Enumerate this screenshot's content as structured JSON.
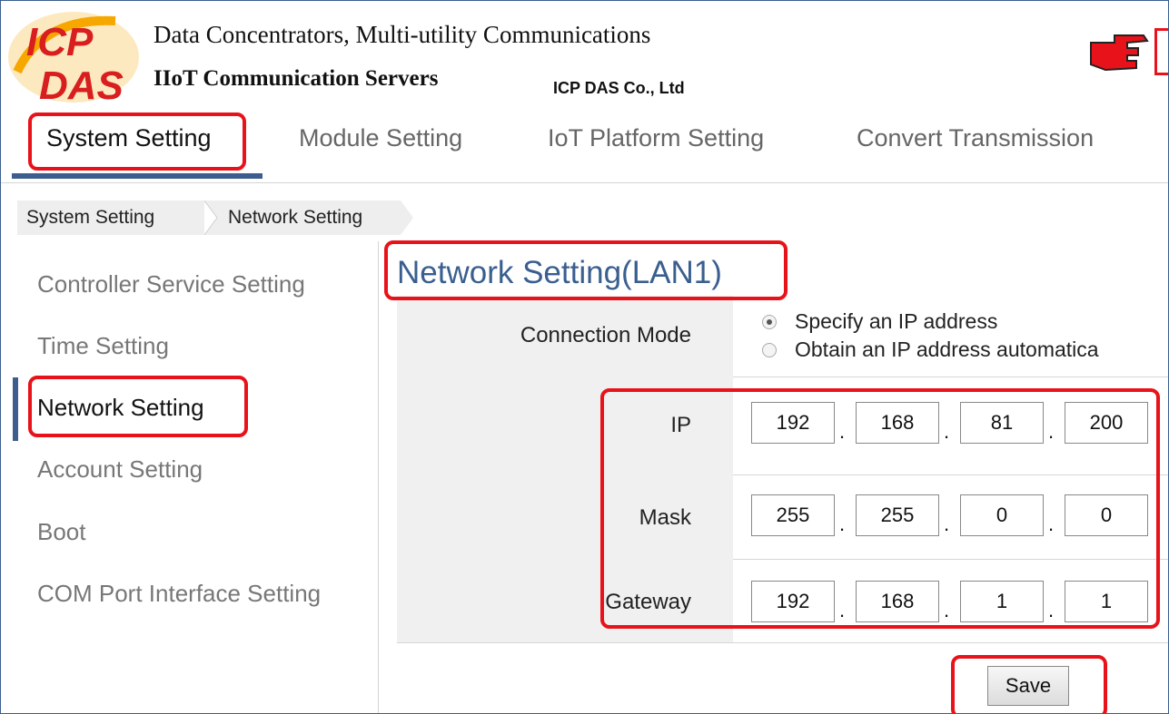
{
  "header": {
    "line1": "Data Concentrators, Multi-utility Communications",
    "line2": "IIoT Communication Servers",
    "company": "ICP DAS Co., Ltd",
    "logo_top": "ICP",
    "logo_bottom": "DAS"
  },
  "topnav": {
    "tabs": [
      {
        "label": "System Setting",
        "active": true
      },
      {
        "label": "Module Setting",
        "active": false
      },
      {
        "label": "IoT Platform Setting",
        "active": false
      },
      {
        "label": "Convert Transmission",
        "active": false
      }
    ]
  },
  "breadcrumb": [
    "System Setting",
    "Network Setting"
  ],
  "sidebar": {
    "items": [
      {
        "label": "Controller Service Setting",
        "active": false
      },
      {
        "label": "Time Setting",
        "active": false
      },
      {
        "label": "Network Setting",
        "active": true
      },
      {
        "label": "Account Setting",
        "active": false
      },
      {
        "label": "Boot",
        "active": false
      },
      {
        "label": "COM Port Interface Setting",
        "active": false
      }
    ]
  },
  "main": {
    "title": "Network Setting(LAN1)",
    "connection_mode": {
      "label": "Connection Mode",
      "options": [
        "Specify an IP address",
        "Obtain an IP address automatica"
      ],
      "selected": "Specify an IP address"
    },
    "ip": {
      "label": "IP",
      "octets": [
        "192",
        "168",
        "81",
        "200"
      ]
    },
    "mask": {
      "label": "Mask",
      "octets": [
        "255",
        "255",
        "0",
        "0"
      ]
    },
    "gateway": {
      "label": "Gateway",
      "octets": [
        "192",
        "168",
        "1",
        "1"
      ]
    },
    "save_label": "Save"
  },
  "colors": {
    "accent": "#3d5d8e",
    "title": "#3a5f8f",
    "annotation": "#e8131a"
  }
}
